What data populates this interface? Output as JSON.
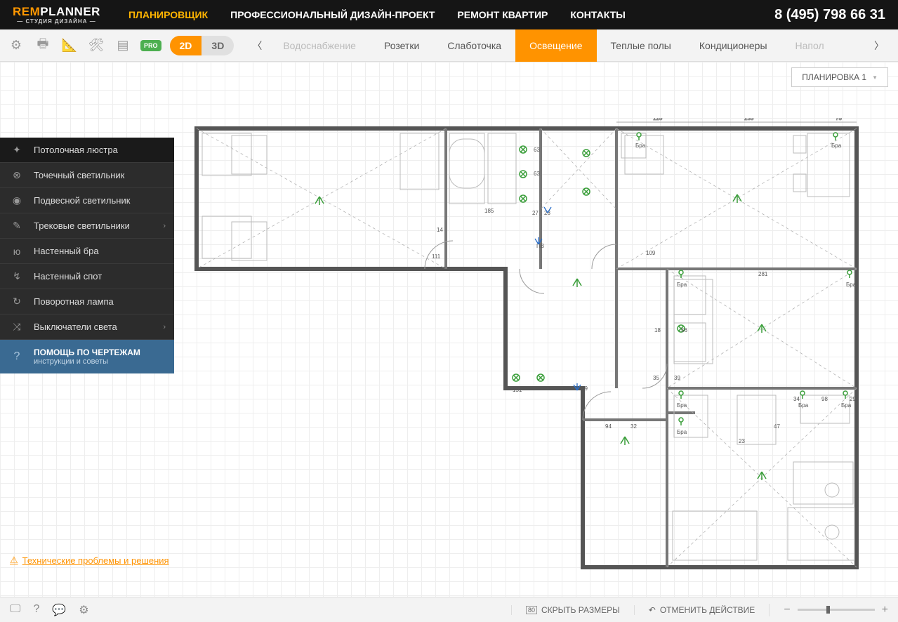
{
  "header": {
    "logo_rem": "REM",
    "logo_planner": "PLANNER",
    "logo_sub": "— СТУДИЯ ДИЗАЙНА —",
    "nav": [
      "ПЛАНИРОВЩИК",
      "ПРОФЕССИОНАЛЬНЫЙ ДИЗАЙН-ПРОЕКТ",
      "РЕМОНТ КВАРТИР",
      "КОНТАКТЫ"
    ],
    "phone": "8 (495) 798 66 31"
  },
  "toolbar": {
    "pro": "PRO",
    "view_2d": "2D",
    "view_3d": "3D",
    "tabs": [
      "Водоснабжение",
      "Розетки",
      "Слаботочка",
      "Освещение",
      "Теплые полы",
      "Кондиционеры",
      "Напол"
    ]
  },
  "layout_dropdown": "ПЛАНИРОВКА 1",
  "side_panel": {
    "items": [
      "Потолочная люстра",
      "Точечный светильник",
      "Подвесной светильник",
      "Трековые светильники",
      "Настенный бра",
      "Настенный спот",
      "Поворотная лампа",
      "Выключатели света"
    ],
    "help_title": "ПОМОЩЬ ПО ЧЕРТЕЖАМ",
    "help_sub": "инструкции и советы"
  },
  "floorplan_labels": {
    "dims": [
      "125",
      "233",
      "75",
      "63",
      "63",
      "185",
      "27",
      "28",
      "14",
      "111",
      "109",
      "281",
      "18",
      "56",
      "35",
      "39",
      "151",
      "94",
      "32",
      "47",
      "23",
      "34",
      "98",
      "29"
    ],
    "bra": "Бра",
    "pv": "ПВ",
    "pg19": "ПГ19"
  },
  "tech_link": "Технические проблемы и решения",
  "footer": {
    "hide_dims": "СКРЫТЬ РАЗМЕРЫ",
    "undo": "ОТМЕНИТЬ ДЕЙСТВИЕ",
    "dim_badge": "80"
  }
}
